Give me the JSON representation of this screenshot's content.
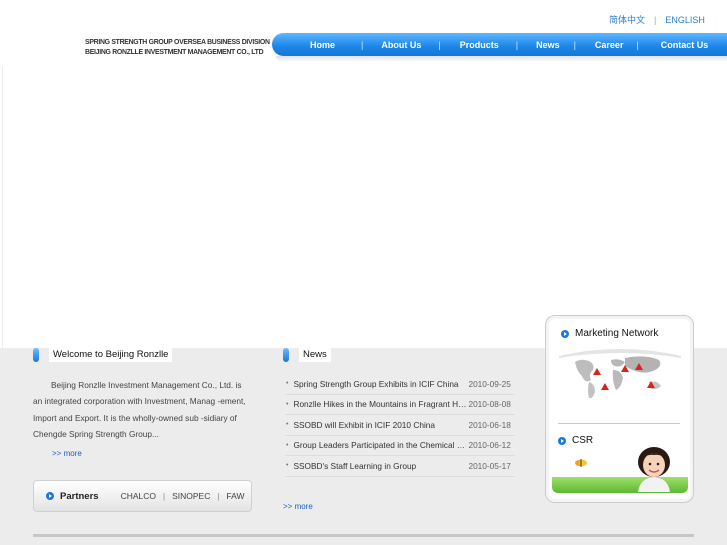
{
  "lang": {
    "chinese": "简体中文",
    "english": "ENGLISH"
  },
  "logo": {
    "line1": "SPRING STRENGTH GROUP OVERSEA BUSINESS DIVISION",
    "line2": "BEIJING RONZLLE INVESTMENT MANAGEMENT CO., LTD"
  },
  "nav": {
    "items": [
      "Home",
      "About Us",
      "Products",
      "News",
      "Career",
      "Contact Us"
    ],
    "separator": "|"
  },
  "welcome": {
    "title": "Welcome to Beijing Ronzlle",
    "text": "Beijing Ronzlle Investment Management Co., Ltd. is an integrated corporation with Investment, Manag -ement, Import and Export. It is the wholly-owned sub -sidiary of Chengde Spring Strength Group...",
    "more": ">> more"
  },
  "partners": {
    "title": "Partners",
    "items": [
      "CHALCO",
      "SINOPEC",
      "FAW"
    ],
    "separator": "|"
  },
  "news": {
    "title": "News",
    "items": [
      {
        "title": "Spring Strength Group Exhibits in ICIF China",
        "date": "2010-09-25"
      },
      {
        "title": "Ronzlle Hikes in the Mountains in Fragrant Hills",
        "date": "2010-08-08"
      },
      {
        "title": "SSOBD will Exhibit in ICIF 2010 China",
        "date": "2010-06-18"
      },
      {
        "title": "Group Leaders Participated in the Chemical Expo",
        "date": "2010-06-12"
      },
      {
        "title": "SSOBD's Staff Learning in Group",
        "date": "2010-05-17"
      }
    ],
    "bullet": "•",
    "more": ">> more"
  },
  "side": {
    "marketing_title": "Marketing Network",
    "csr_title": "CSR"
  },
  "colors": {
    "accent": "#1a85e8",
    "link": "#1a5fc0",
    "marker": "#d9241c"
  }
}
